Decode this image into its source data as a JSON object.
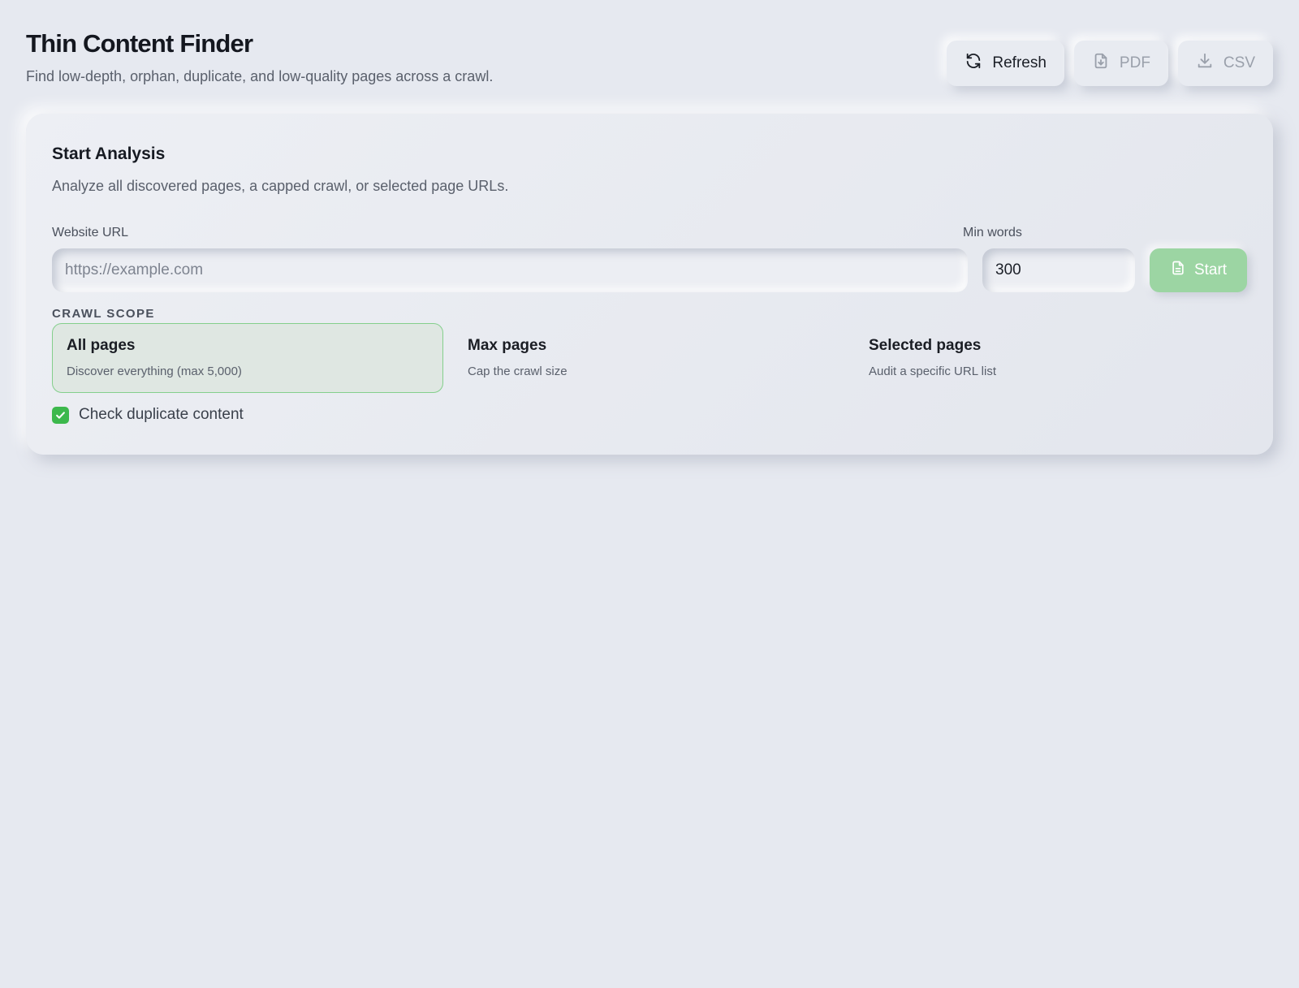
{
  "header": {
    "title": "Thin Content Finder",
    "subtitle": "Find low-depth, orphan, duplicate, and low-quality pages across a crawl."
  },
  "toolbar": {
    "refresh_label": "Refresh",
    "pdf_label": "PDF",
    "csv_label": "CSV"
  },
  "analysis": {
    "title": "Start Analysis",
    "description": "Analyze all discovered pages, a capped crawl, or selected page URLs.",
    "url_label": "Website URL",
    "url_placeholder": "https://example.com",
    "url_value": "",
    "min_words_label": "Min words",
    "min_words_value": "300",
    "start_label": "Start",
    "scope_label": "CRAWL SCOPE",
    "scope_options": [
      {
        "title": "All pages",
        "description": "Discover everything (max 5,000)",
        "selected": true
      },
      {
        "title": "Max pages",
        "description": "Cap the crawl size",
        "selected": false
      },
      {
        "title": "Selected pages",
        "description": "Audit a specific URL list",
        "selected": false
      }
    ],
    "duplicate_check_label": "Check duplicate content",
    "duplicate_check_checked": true
  },
  "colors": {
    "accent": "#3cb84c",
    "start_button": "#9cd5a3",
    "selected_border": "#84cf8c",
    "background": "#e6e9f0"
  },
  "icons": {
    "refresh": "refresh-icon",
    "pdf": "file-download-icon",
    "csv": "download-icon",
    "start": "document-icon",
    "check": "checkmark-icon"
  }
}
